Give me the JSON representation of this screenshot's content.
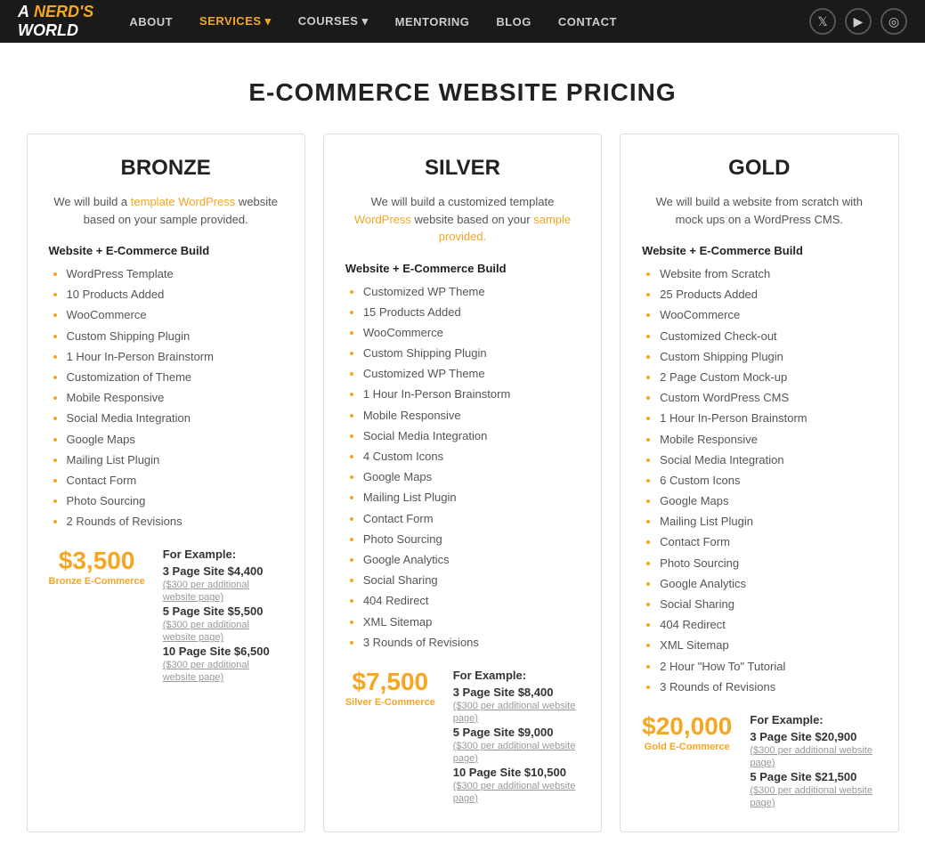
{
  "nav": {
    "logo": "A NERD'S WORLD",
    "links": [
      {
        "label": "ABOUT",
        "active": false,
        "has_arrow": false
      },
      {
        "label": "SERVICES",
        "active": true,
        "has_arrow": true
      },
      {
        "label": "COURSES",
        "active": false,
        "has_arrow": true
      },
      {
        "label": "MENTORING",
        "active": false,
        "has_arrow": false
      },
      {
        "label": "BLOG",
        "active": false,
        "has_arrow": false
      },
      {
        "label": "CONTACT",
        "active": false,
        "has_arrow": false
      }
    ],
    "icons": [
      "twitter",
      "youtube",
      "instagram"
    ]
  },
  "page": {
    "title": "E-COMMERCE WEBSITE PRICING"
  },
  "plans": [
    {
      "id": "bronze",
      "title": "BRONZE",
      "description": "We will build a template WordPress website based on your sample provided.",
      "section_label": "Website + E-Commerce Build",
      "features": [
        "WordPress Template",
        "10 Products Added",
        "WooCommerce",
        "Custom Shipping Plugin",
        "1 Hour In-Person Brainstorm",
        "Customization of Theme",
        "Mobile Responsive",
        "Social Media Integration",
        "Google Maps",
        "Mailing List Plugin",
        "Contact Form",
        "Photo Sourcing",
        "2 Rounds of Revisions"
      ],
      "for_example": "For Example:",
      "price_amount": "$3,500",
      "price_label": "Bronze E-Commerce",
      "examples": [
        {
          "label": "3 Page Site $4,400",
          "sub": "($300 per additional website page)"
        },
        {
          "label": "5 Page Site $5,500",
          "sub": "($300 per additional website page)"
        },
        {
          "label": "10 Page Site $6,500",
          "sub": "($300 per additional website page)"
        }
      ]
    },
    {
      "id": "silver",
      "title": "SILVER",
      "description": "We will build a customized template WordPress website based on your sample provided.",
      "section_label": "Website + E-Commerce Build",
      "features": [
        "Customized WP Theme",
        "15 Products Added",
        "WooCommerce",
        "Custom Shipping Plugin",
        "Customized WP Theme",
        "1 Hour In-Person Brainstorm",
        "Mobile Responsive",
        "Social Media Integration",
        "4 Custom Icons",
        "Google Maps",
        "Mailing List Plugin",
        "Contact Form",
        "Photo Sourcing",
        "Google Analytics",
        "Social Sharing",
        "404 Redirect",
        "XML Sitemap",
        "3 Rounds of Revisions"
      ],
      "for_example": "For Example:",
      "price_amount": "$7,500",
      "price_label": "Silver E-Commerce",
      "examples": [
        {
          "label": "3 Page Site $8,400",
          "sub": "($300 per additional website page)"
        },
        {
          "label": "5 Page Site $9,000",
          "sub": "($300 per additional website page)"
        },
        {
          "label": "10 Page Site $10,500",
          "sub": "($300 per additional website page)"
        }
      ]
    },
    {
      "id": "gold",
      "title": "GOLD",
      "description": "We will build a website from scratch with mock ups on a WordPress CMS.",
      "section_label": "Website + E-Commerce Build",
      "features": [
        "Website from Scratch",
        "25 Products Added",
        "WooCommerce",
        "Customized Check-out",
        "Custom Shipping Plugin",
        "2 Page Custom Mock-up",
        "Custom WordPress CMS",
        "1 Hour In-Person Brainstorm",
        "Mobile Responsive",
        "Social Media Integration",
        "6 Custom Icons",
        "Google Maps",
        "Mailing List Plugin",
        "Contact Form",
        "Photo Sourcing",
        "Google Analytics",
        "Social Sharing",
        "404 Redirect",
        "XML Sitemap",
        "2 Hour \"How To\" Tutorial",
        "3 Rounds of Revisions"
      ],
      "for_example": "For Example:",
      "price_amount": "$20,000",
      "price_label": "Gold E-Commerce",
      "examples": [
        {
          "label": "3 Page Site $20,900",
          "sub": "($300 per additional website page)"
        },
        {
          "label": "5 Page Site $21,500",
          "sub": "($300 per additional website page)"
        }
      ]
    }
  ]
}
